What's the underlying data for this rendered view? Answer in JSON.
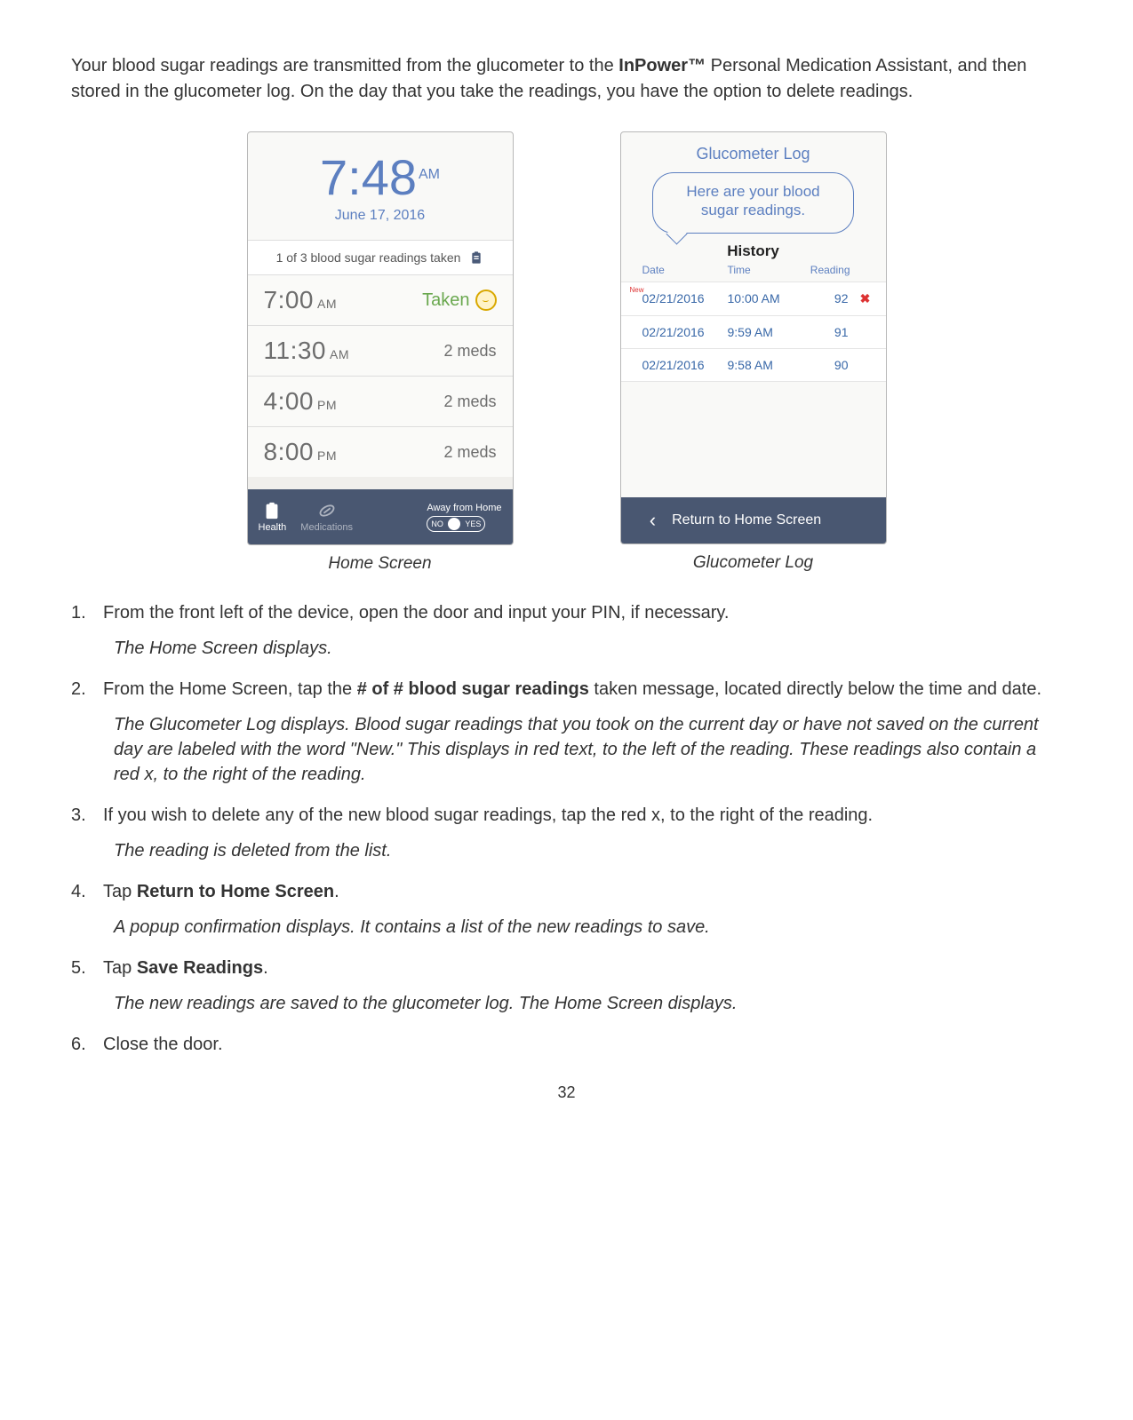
{
  "intro_pre": "Your blood sugar readings are transmitted from the glucometer to the ",
  "brand": "InPower™",
  "intro_post": " Personal Medication Assistant, and then stored in the glucometer log. On the day that you take the readings, you have the option to delete readings.",
  "home_screen": {
    "time": "7:48",
    "ampm": "AM",
    "date": "June 17, 2016",
    "readings_bar": "1 of 3 blood sugar readings taken",
    "rows": [
      {
        "time": "7:00",
        "ampm": "AM",
        "status": "Taken",
        "taken": true
      },
      {
        "time": "11:30",
        "ampm": "AM",
        "status": "2 meds",
        "taken": false
      },
      {
        "time": "4:00",
        "ampm": "PM",
        "status": "2 meds",
        "taken": false
      },
      {
        "time": "8:00",
        "ampm": "PM",
        "status": "2 meds",
        "taken": false
      }
    ],
    "tabs": {
      "health": "Health",
      "meds": "Medications"
    },
    "away_label": "Away from Home",
    "toggle_no": "NO",
    "toggle_yes": "YES",
    "caption": "Home Screen"
  },
  "glucometer": {
    "title": "Glucometer Log",
    "bubble_l1": "Here are your blood",
    "bubble_l2": "sugar readings.",
    "history": "History",
    "cols": {
      "date": "Date",
      "time": "Time",
      "reading": "Reading"
    },
    "rows": [
      {
        "is_new": true,
        "date": "02/21/2016",
        "time": "10:00 AM",
        "reading": "92",
        "deletable": true,
        "del": "✖"
      },
      {
        "is_new": false,
        "date": "02/21/2016",
        "time": "9:59 AM",
        "reading": "91",
        "deletable": false
      },
      {
        "is_new": false,
        "date": "02/21/2016",
        "time": "9:58 AM",
        "reading": "90",
        "deletable": false
      }
    ],
    "new_tag": "New",
    "return_label": "Return to Home Screen",
    "caption": "Glucometer Log"
  },
  "steps": {
    "s1_num": "1.",
    "s1": "From the front left of the device, open the door and input your PIN, if necessary.",
    "r1": "The Home Screen displays.",
    "s2_num": "2.",
    "s2_pre": "From the Home Screen, tap the ",
    "s2_bold": "# of # blood sugar readings",
    "s2_post": " taken message, located directly below the time and date.",
    "r2": "The Glucometer Log displays. Blood sugar readings that you took on the current day or have not saved on the current day are labeled with the word \"New.\" This displays in red text, to the left of the reading. These readings also contain a red x, to the right of the reading.",
    "s3_num": "3.",
    "s3": "If you wish to delete any of the new blood sugar readings, tap the red x, to the right of the reading.",
    "r3": "The reading is deleted from the list.",
    "s4_num": "4.",
    "s4_pre": "Tap ",
    "s4_bold": "Return to Home Screen",
    "s4_post": ".",
    "r4": "A popup confirmation displays.  It contains a list of the new readings to save.",
    "s5_num": "5.",
    "s5_pre": "Tap ",
    "s5_bold": "Save Readings",
    "s5_post": ".",
    "r5": "The new readings are saved to the glucometer log. The Home Screen displays.",
    "s6_num": "6.",
    "s6": "Close the door."
  },
  "page_num": "32"
}
